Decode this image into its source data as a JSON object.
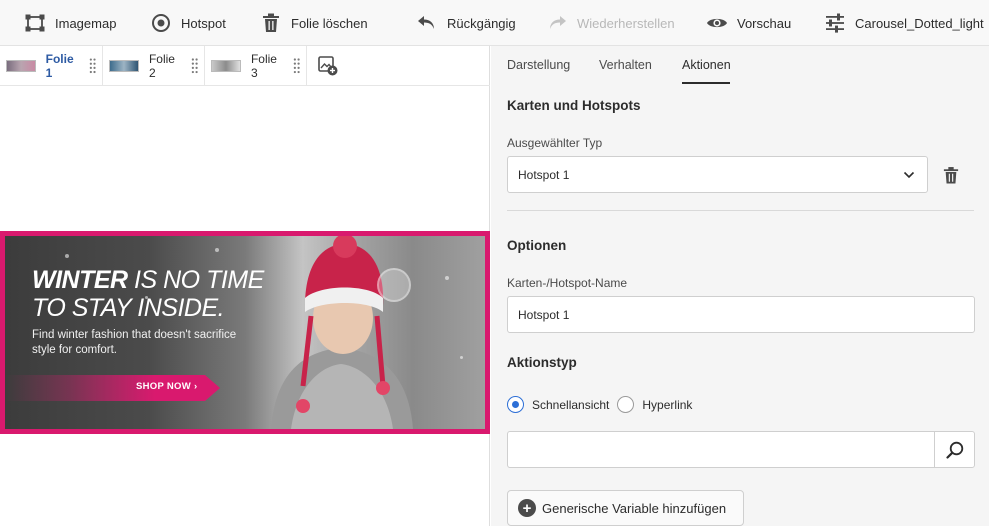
{
  "toolbar": {
    "imagemap": "Imagemap",
    "hotspot": "Hotspot",
    "delete_slide": "Folie löschen",
    "undo": "Rückgängig",
    "redo": "Wiederherstellen",
    "preview": "Vorschau",
    "preset": "Carousel_Dotted_light"
  },
  "slides": [
    {
      "label": "Folie 1",
      "active": true
    },
    {
      "label": "Folie 2",
      "active": false
    },
    {
      "label": "Folie 3",
      "active": false
    }
  ],
  "banner": {
    "title_bold": "WINTER",
    "title_rest": " IS NO TIME",
    "title_line2": "TO STAY INSIDE.",
    "subtitle": "Find winter fashion that doesn't sacrifice style for comfort.",
    "cta": "SHOP NOW ›"
  },
  "panel": {
    "tabs": [
      "Darstellung",
      "Verhalten",
      "Aktionen"
    ],
    "active_tab": "Aktionen",
    "section_maps": "Karten und Hotspots",
    "selected_type_label": "Ausgewählter Typ",
    "selected_type_value": "Hotspot 1",
    "section_options": "Optionen",
    "name_label": "Karten-/Hotspot-Name",
    "name_value": "Hotspot 1",
    "section_action": "Aktionstyp",
    "radio_quickview": "Schnellansicht",
    "radio_hyperlink": "Hyperlink",
    "search_value": "",
    "add_variable": "Generische Variable hinzufügen"
  },
  "colors": {
    "accent_pink": "#d9196e",
    "active_tab_blue": "#2d5aa3",
    "radio_blue": "#2d6fd6"
  }
}
